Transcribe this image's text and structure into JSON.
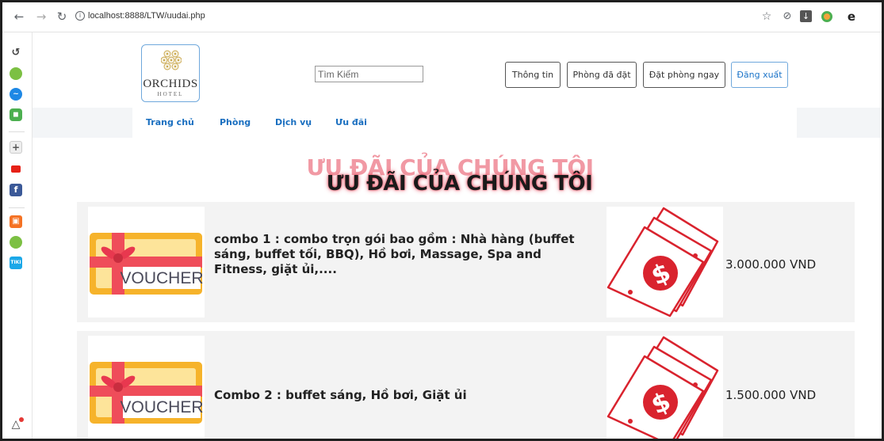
{
  "browser": {
    "url": "localhost:8888/LTW/uudai.php",
    "nav_icons": {
      "back": "arrow-left-icon",
      "forward": "arrow-right-icon",
      "reload": "reload-icon"
    }
  },
  "sidebar": {
    "items": [
      "history-icon",
      "green-app-icon",
      "messenger-icon",
      "game-icon",
      "add-icon",
      "youtube-icon",
      "facebook-icon",
      "shop-icon",
      "green-app-2-icon",
      "tiki-icon",
      "bell-icon"
    ]
  },
  "header": {
    "logo_text": "ORCHIDS",
    "logo_sub": "HOTEL",
    "search_placeholder": "Tìm Kiếm",
    "buttons": {
      "info": "Thông tin",
      "booked": "Phòng đã đặt",
      "book_now": "Đặt phòng ngay",
      "logout": "Đăng xuất"
    }
  },
  "nav": {
    "home": "Trang chủ",
    "rooms": "Phòng",
    "services": "Dịch vụ",
    "offers": "Ưu đãi"
  },
  "main": {
    "title": "ƯU ĐÃI CỦA CHÚNG TÔI",
    "offers": [
      {
        "voucher_label": "VOUCHER",
        "description": "combo 1 : combo trọn gói bao gồm : Nhà hàng (buffet sáng, buffet tối, BBQ), Hồ bơi, Massage, Spa and Fitness, giặt ủi,....",
        "price": "3.000.000 VND"
      },
      {
        "voucher_label": "VOUCHER",
        "description": "Combo 2 : buffet sáng, Hồ bơi, Giặt ủi",
        "price": "1.500.000 VND"
      }
    ]
  },
  "colors": {
    "link_blue": "#1a6fc0",
    "heading_glow": "#e6465a",
    "voucher_orange": "#f6b32b",
    "ribbon_red": "#e8384f",
    "money_red": "#d9232e"
  }
}
